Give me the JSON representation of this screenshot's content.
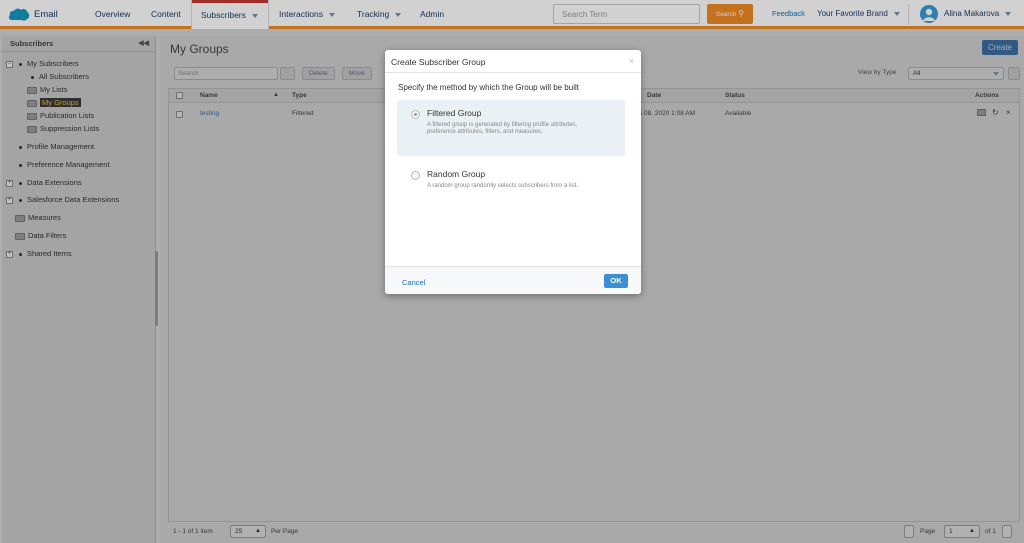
{
  "header": {
    "app_name": "Email",
    "nav": [
      "Overview",
      "Content",
      "Subscribers",
      "Interactions",
      "Tracking",
      "Admin"
    ],
    "search_placeholder": "Search Term",
    "search_button": "Search",
    "feedback": "Feedback",
    "brand": "Your Favorite Brand",
    "user": "Alina Makarova",
    "accent_color": "#f08a24"
  },
  "sidebar": {
    "title": "Subscribers",
    "items": {
      "my_subscribers": "My Subscribers",
      "all_subscribers": "All Subscribers",
      "my_lists": "My Lists",
      "my_groups": "My Groups",
      "publication_lists": "Publication Lists",
      "suppression_lists": "Suppression Lists",
      "profile_management": "Profile Management",
      "preference_management": "Preference Management",
      "data_extensions": "Data Extensions",
      "salesforce_data_extensions": "Salesforce Data Extensions",
      "measures": "Measures",
      "data_filters": "Data Filters",
      "shared_items": "Shared Items"
    }
  },
  "main": {
    "title": "My Groups",
    "create_button": "Create",
    "toolbar": {
      "search_placeholder": "Search",
      "delete": "Delete",
      "move": "Move",
      "view_by_type_label": "View by Type",
      "view_by_type_value": "All"
    },
    "grid": {
      "columns": [
        "Name",
        "Type",
        "Date",
        "Status",
        "Actions"
      ],
      "rows": [
        {
          "name": "testing",
          "type": "Filtered",
          "date": "s 08, 2020 1:08 AM",
          "status": "Available"
        }
      ]
    },
    "pager": {
      "range": "1 - 1 of 1 item",
      "per_page_value": "25",
      "per_page_label": "Per Page",
      "page_label": "Page",
      "page_value": "1",
      "of_total": "of 1"
    }
  },
  "modal": {
    "title": "Create Subscriber Group",
    "close": "×",
    "instruction": "Specify the method by which the Group will be built",
    "options": [
      {
        "title": "Filtered Group",
        "description": "A filtered group is generated by filtering profile attributes, preference attributes, filters, and measures.",
        "selected": true
      },
      {
        "title": "Random Group",
        "description": "A random group randomly selects subscribers from a list.",
        "selected": false
      }
    ],
    "cancel": "Cancel",
    "ok": "OK"
  }
}
